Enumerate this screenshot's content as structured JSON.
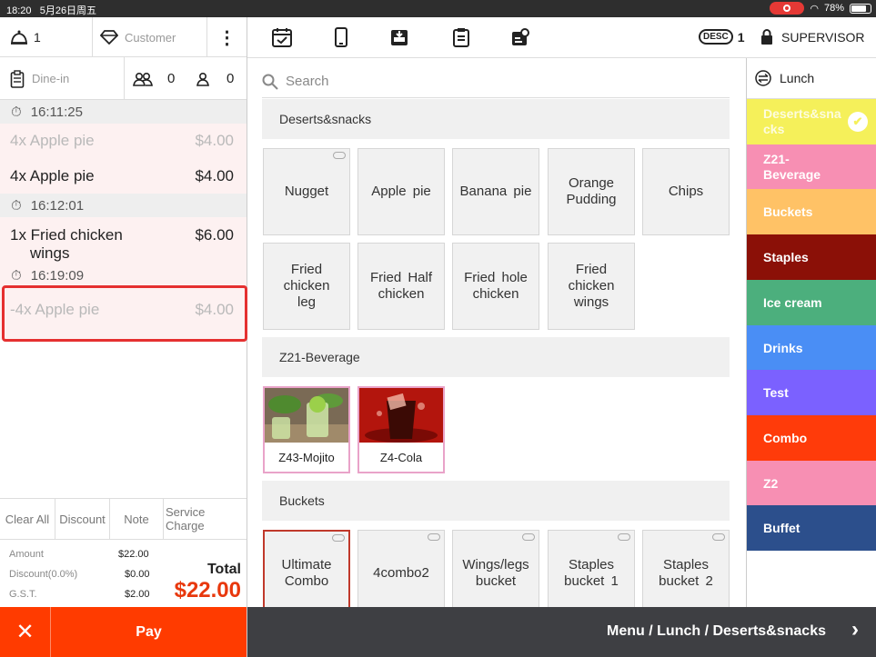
{
  "status": {
    "time": "18:20",
    "date": "5月26日周五",
    "battery": "78%"
  },
  "left": {
    "guest_count": "1",
    "customer_placeholder": "Customer",
    "order_type": "Dine-in",
    "adults": "0",
    "children": "0",
    "entries": [
      {
        "time": "16:11:25"
      },
      {
        "qty_name": "4x Apple pie",
        "price": "$4.00",
        "void": true
      },
      {
        "qty_name": "4x Apple pie",
        "price": "$4.00",
        "void": false
      },
      {
        "time": "16:12:01"
      },
      {
        "qty_name": "1x Fried chicken",
        "line2": "wings",
        "price": "$6.00",
        "void": false
      },
      {
        "time": "16:19:09"
      },
      {
        "qty_name": "-4x Apple pie",
        "price": "$4.00",
        "void": true
      }
    ],
    "actions": {
      "clear_all": "Clear All",
      "discount": "Discount",
      "note": "Note",
      "service_charge": "Service Charge"
    },
    "totals": {
      "amount_label": "Amount",
      "amount": "$22.00",
      "discount_label": "Discount(0.0%)",
      "discount": "$0.00",
      "gst_label": "G.S.T.",
      "gst": "$2.00",
      "total_label": "Total",
      "total": "$22.00"
    },
    "pay_label": "Pay"
  },
  "toolbar": {
    "desc_label": "DESC",
    "desc_count": "1",
    "role": "SUPERVISOR"
  },
  "search": {
    "placeholder": "Search"
  },
  "sections": [
    {
      "title": "Deserts&snacks",
      "items": [
        "Nugget",
        "Apple pie",
        "Banana pie",
        "Orange Pudding",
        "Chips",
        "Fried chicken leg",
        "Fried Half chicken",
        "Fried hole chicken",
        "Fried chicken wings"
      ]
    },
    {
      "title": "Z21-Beverage",
      "items": [
        "Z43-Mojito",
        "Z4-Cola"
      ]
    },
    {
      "title": "Buckets",
      "items": [
        "Ultimate Combo",
        "4combo2",
        "Wings/legs bucket",
        "Staples bucket 1",
        "Staples bucket 2"
      ]
    }
  ],
  "categories": {
    "menu_name": "Lunch",
    "items": [
      {
        "label": "Deserts&snacks",
        "color": "#f5f05a"
      },
      {
        "label": "Z21-Beverage",
        "color": "#f78fb3"
      },
      {
        "label": "Buckets",
        "color": "#ffc266"
      },
      {
        "label": "Staples",
        "color": "#8b1007"
      },
      {
        "label": "Ice cream",
        "color": "#4caf7d"
      },
      {
        "label": "Drinks",
        "color": "#4a8ef5"
      },
      {
        "label": "Test",
        "color": "#7b61ff"
      },
      {
        "label": "Combo",
        "color": "#ff3b0a"
      },
      {
        "label": "Z2",
        "color": "#f78fb3"
      },
      {
        "label": "Buffet",
        "color": "#2c4f8c"
      }
    ]
  },
  "breadcrumb": "Menu / Lunch / Deserts&snacks"
}
